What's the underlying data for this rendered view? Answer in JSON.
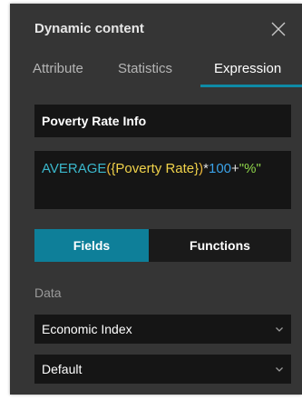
{
  "panel": {
    "title": "Dynamic content",
    "close_icon": "close-icon"
  },
  "tabs": [
    {
      "label": "Attribute",
      "active": false
    },
    {
      "label": "Statistics",
      "active": false
    },
    {
      "label": "Expression",
      "active": true
    }
  ],
  "expression_name": "Poverty Rate Info",
  "expression": {
    "function": "AVERAGE",
    "open_paren": "(",
    "field": "{Poverty Rate}",
    "close_paren": ")",
    "op1": "*",
    "number": "100",
    "op2": "+",
    "string": "\"%\""
  },
  "toggle": {
    "fields_label": "Fields",
    "functions_label": "Functions",
    "selected": "Fields"
  },
  "data_section": {
    "label": "Data",
    "layer_select": "Economic Index",
    "view_select": "Default"
  },
  "colors": {
    "panel_bg": "#353535",
    "input_bg": "#151515",
    "accent": "#0e8aa6"
  }
}
